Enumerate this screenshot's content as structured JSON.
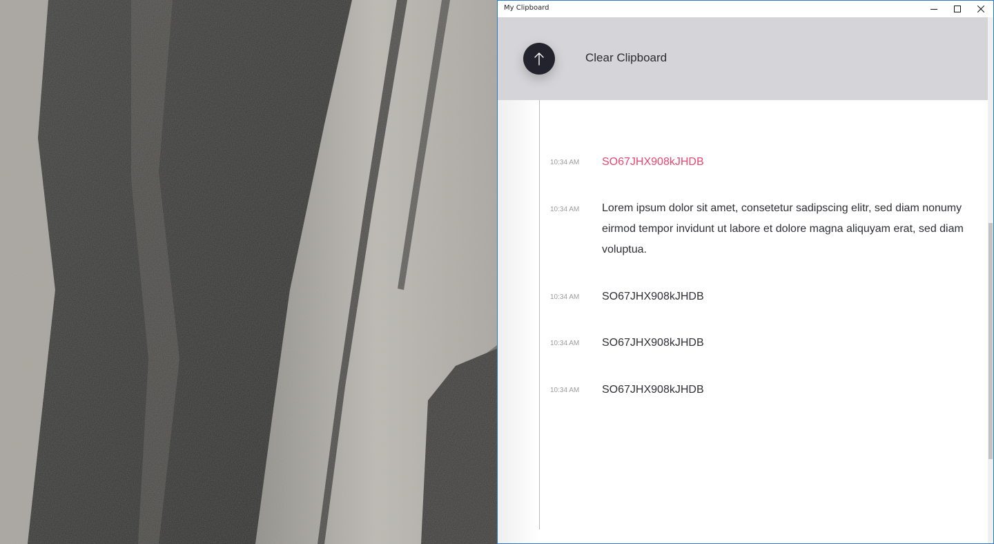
{
  "window": {
    "title": "My Clipboard",
    "controls": {
      "minimize_icon": "minimize-icon",
      "maximize_icon": "maximize-icon",
      "close_icon": "close-icon"
    }
  },
  "header": {
    "button_icon": "arrow-up-icon",
    "clear_label": "Clear Clipboard"
  },
  "entries": [
    {
      "time": "10:34 AM",
      "text": "SO67JHX908kJHDB",
      "highlighted": true
    },
    {
      "time": "10:34 AM",
      "text": "Lorem ipsum dolor sit amet, consetetur sadipscing elitr, sed diam nonumy eirmod tempor invidunt ut labore et dolore magna aliquyam erat, sed diam voluptua.",
      "highlighted": false
    },
    {
      "time": "10:34 AM",
      "text": "SO67JHX908kJHDB",
      "highlighted": false
    },
    {
      "time": "10:34 AM",
      "text": "SO67JHX908kJHDB",
      "highlighted": false
    },
    {
      "time": "10:34 AM",
      "text": "SO67JHX908kJHDB",
      "highlighted": false
    }
  ],
  "colors": {
    "accent_highlight": "#e8466f",
    "header_bg": "#d5d5d9",
    "button_bg": "#23232e",
    "window_border": "#2b78c5"
  }
}
